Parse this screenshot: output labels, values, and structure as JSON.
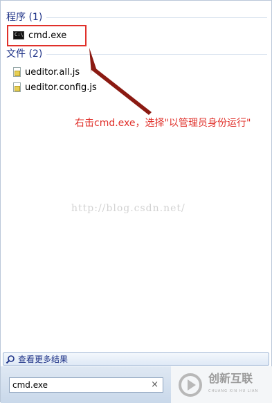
{
  "programs_group": {
    "title": "程序 (1)",
    "items": [
      {
        "label": "cmd.exe",
        "icon": "cmd-icon"
      }
    ]
  },
  "files_group": {
    "title": "文件 (2)",
    "items": [
      {
        "label": "ueditor.all.js",
        "icon": "js-file-icon"
      },
      {
        "label": "ueditor.config.js",
        "icon": "js-file-icon"
      }
    ]
  },
  "annotation": {
    "text": "右击cmd.exe，选择\"以管理员身份运行\"",
    "color": "#e0302a"
  },
  "watermark": {
    "text": "http://blog.csdn.net/"
  },
  "more_results": {
    "label": "查看更多结果"
  },
  "search": {
    "value": "cmd.exe",
    "clear_icon": "×"
  },
  "logo": {
    "name": "创新互联",
    "subtitle": "CHUANG XIN HU LIAN"
  },
  "colors": {
    "header": "#1e3287",
    "highlight": "#e0302a",
    "arrow": "#8b1a12"
  }
}
